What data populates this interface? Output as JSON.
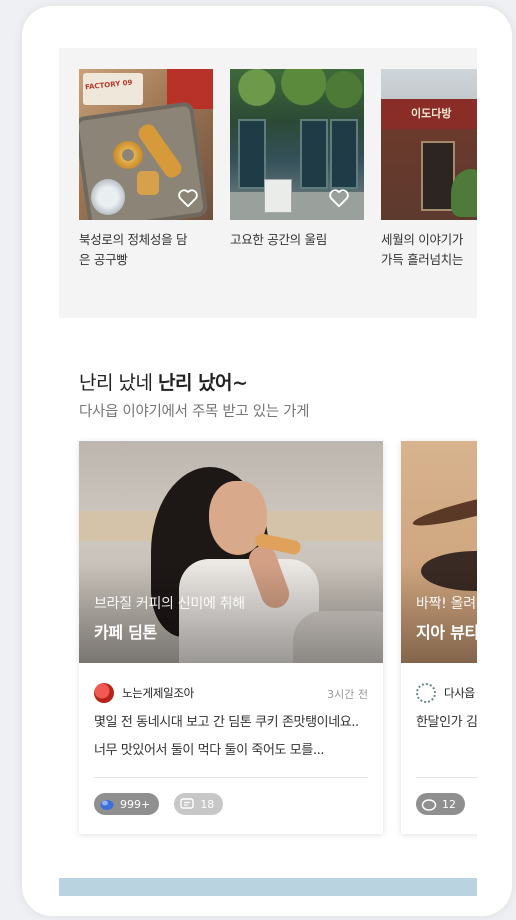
{
  "top_cards": [
    {
      "title": "북성로의 정체성을 담\n은 공구빵",
      "logo_text": "FACTORY 09"
    },
    {
      "title": "고요한 공간의 울림"
    },
    {
      "title": "세월의 이야기가\n가득 흘러넘치는",
      "sign_text": "이도다방"
    }
  ],
  "section": {
    "title_normal": "난리 났네 ",
    "title_bold": "난리 났어~",
    "subtitle": "다사읍 이야기에서 주목 받고 있는 가게"
  },
  "feature_cards": [
    {
      "kicker": "브라질 커피의 신미에 취해",
      "heading": "카페 딤톤",
      "author": "노는게제일조아",
      "time": "3시간 전",
      "text": "몇일 전 동네시대 보고 간 딤톤 쿠키 존맛탱이네요.. 너무 맛있어서 둘이 먹다 둘이 죽어도 모를...",
      "reaction_count": "999+",
      "comment_count": "18"
    },
    {
      "kicker": "바짝! 올려",
      "heading": "지아 뷰티",
      "author": "다사읍",
      "text": "한달인가 김 속눈썹도 리",
      "reaction_count": "12"
    }
  ],
  "icons": {
    "heart": "heart-outline-icon",
    "reaction": "clap-icon",
    "comment": "comment-icon"
  },
  "colors": {
    "top_bg": "#f4f4f5",
    "chip_dark": "#8f8f8f",
    "chip_light": "#c7c7c7",
    "bottom_bar": "#b9d4e0"
  }
}
